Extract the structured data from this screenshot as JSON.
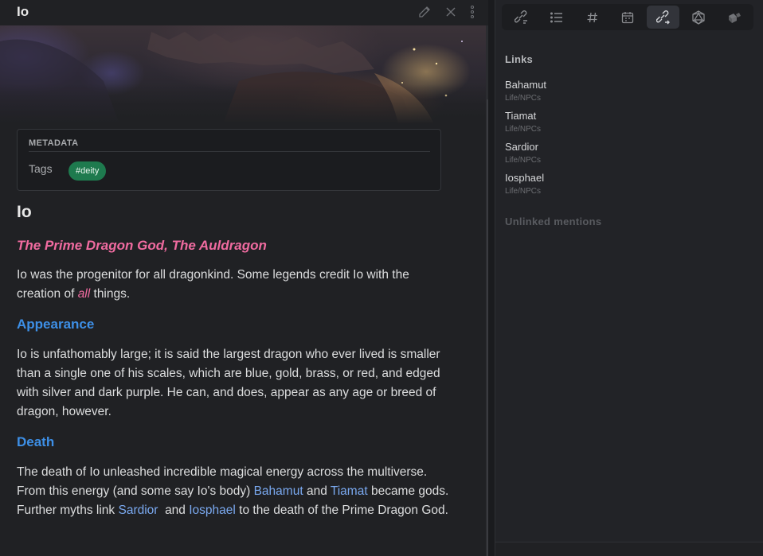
{
  "note": {
    "tab_title": "Io",
    "metadata": {
      "heading": "METADATA",
      "tags_label": "Tags",
      "tags": [
        "#deity"
      ]
    },
    "heading": "Io",
    "subtitle": "The Prime Dragon God, The Auldragon",
    "intro": {
      "text_before": "Io was the progenitor for all dragonkind. Some legends credit Io with the creation of ",
      "emphasis": "all",
      "text_after": " things."
    },
    "appearance": {
      "heading": "Appearance",
      "text": "Io is unfathomably large; it is said the largest dragon who ever lived is smaller than a single one of his scales, which are blue, gold, brass, or red, and edged with silver and dark purple. He can, and does, appear as any age or breed of dragon, however."
    },
    "death": {
      "heading": "Death",
      "text_1": "The death of Io unleashed incredible magical energy across the multiverse. From this energy (and some say Io's body) ",
      "link_1": "Bahamut",
      "text_2": " and ",
      "link_2": "Tiamat",
      "text_3": " became gods. Further myths link ",
      "link_3": "Sardior",
      "text_4": "  and ",
      "link_4": "Iosphael",
      "text_5": " to the death of the Prime Dragon God."
    }
  },
  "header_icons": [
    "edit-pencil-icon",
    "close-icon",
    "more-options-icon"
  ],
  "sidebar": {
    "toolbar_icons": [
      "backlinks-icon",
      "outline-list-icon",
      "hashtag-icon",
      "calendar-icon",
      "outgoing-links-icon",
      "d20-dice-icon",
      "dice-icon"
    ],
    "active_tool": "outgoing-links-icon",
    "links_heading": "Links",
    "links": [
      {
        "name": "Bahamut",
        "path": "Life/NPCs"
      },
      {
        "name": "Tiamat",
        "path": "Life/NPCs"
      },
      {
        "name": "Sardior",
        "path": "Life/NPCs"
      },
      {
        "name": "Iosphael",
        "path": "Life/NPCs"
      }
    ],
    "unlinked_heading": "Unlinked mentions"
  },
  "colors": {
    "accent_heading": "#3d8fe6",
    "accent_pink": "#f06ba0",
    "tag_green": "#1e7a4e",
    "link_blue": "#7aa9f0"
  }
}
